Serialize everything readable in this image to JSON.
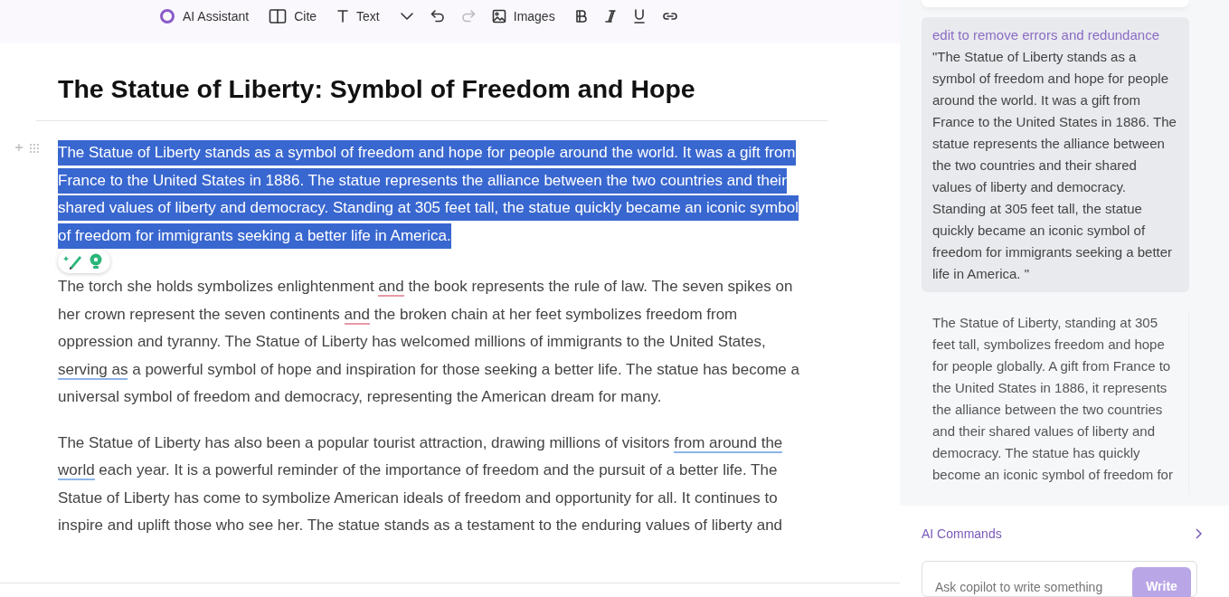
{
  "toolbar": {
    "items": [
      {
        "kind": "ai",
        "label": "AI Assistant"
      },
      {
        "kind": "cite",
        "label": "Cite"
      },
      {
        "kind": "text",
        "label": "Text"
      },
      {
        "kind": "caret"
      },
      {
        "kind": "undo",
        "disabled": false
      },
      {
        "kind": "redo",
        "disabled": true
      },
      {
        "kind": "images",
        "label": "Images"
      },
      {
        "kind": "bold"
      },
      {
        "kind": "italic"
      },
      {
        "kind": "underline"
      },
      {
        "kind": "link"
      }
    ]
  },
  "document": {
    "title": "The Statue of Liberty: Symbol of Freedom and Hope",
    "paragraphs": [
      {
        "selected": true,
        "parts": [
          {
            "kind": "plain",
            "text": "The Statue of Liberty stands as a symbol of freedom and hope for people around the world. It was a gift from France to the United States in 1886. The statue represents the alliance between the two countries and their shared values of liberty and democracy. Standing at 305 feet tall, the statue quickly became an iconic symbol of freedom for immigrants seeking a better life in America."
          }
        ]
      },
      {
        "selected": false,
        "parts": [
          {
            "kind": "plain",
            "text": "The torch she holds symbolizes enlightenment "
          },
          {
            "kind": "grammar",
            "text": "and"
          },
          {
            "kind": "plain",
            "text": " the book represents the rule of law. The seven spikes on her crown represent the seven continents "
          },
          {
            "kind": "grammar",
            "text": "and"
          },
          {
            "kind": "plain",
            "text": " the broken chain at her feet symbolizes freedom from oppression and tyranny. The Statue of Liberty has welcomed millions of immigrants to the United States, "
          },
          {
            "kind": "style",
            "text": "serving as"
          },
          {
            "kind": "plain",
            "text": " a powerful symbol of hope and inspiration for those seeking a better life. The statue has become a universal symbol of freedom and democracy, representing the American dream for many."
          }
        ]
      },
      {
        "selected": false,
        "parts": [
          {
            "kind": "plain",
            "text": "The Statue of Liberty has also been a popular tourist attraction, drawing millions of visitors "
          },
          {
            "kind": "style",
            "text": "from around the world"
          },
          {
            "kind": "plain",
            "text": " each year. It is a powerful reminder of the importance of freedom and the pursuit of a better life. The Statue of Liberty has come to symbolize American ideals of freedom and opportunity for all. It continues to inspire and uplift those who see her. The statue stands as a testament to the enduring values of liberty and"
          }
        ]
      }
    ]
  },
  "assistant": {
    "prompt": {
      "command": "edit to remove errors and redundance",
      "quote": "\"The Statue of Liberty stands as a symbol of freedom and hope for people around the world. It was a gift from France to the United States in 1886. The statue represents the alliance between the two countries and their shared values of liberty and democracy. Standing at 305 feet tall, the statue quickly became an iconic symbol of freedom for immigrants seeking a better life in America. \""
    },
    "response": "The Statue of Liberty, standing at 305 feet tall, symbolizes freedom and hope for people globally. A gift from France to the United States in 1886, it represents the alliance between the two countries and their shared values of liberty and democracy. The statue has quickly become an iconic symbol of freedom for",
    "commands_label": "AI Commands",
    "input": {
      "placeholder": "Ask copilot to write something",
      "button": "Write"
    }
  }
}
